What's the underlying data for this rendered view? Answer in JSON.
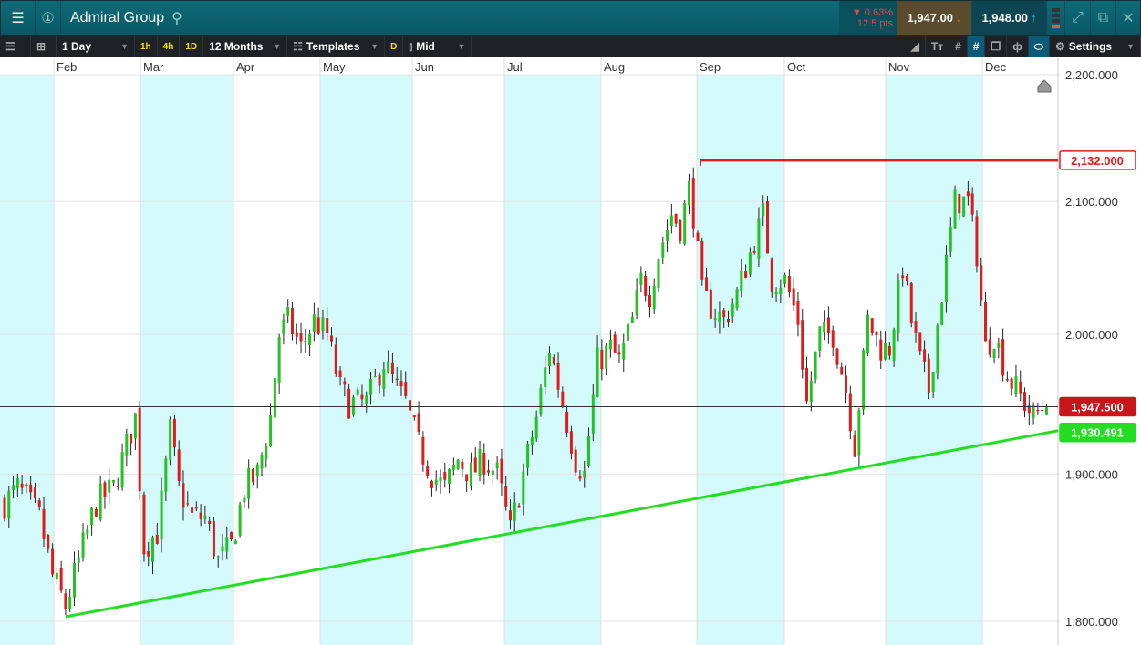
{
  "header": {
    "title": "Admiral Group",
    "change_pct": "▼ 0.63%",
    "change_pts": "12.5 pts",
    "sell": "1,947.00",
    "buy": "1,948.00"
  },
  "toolbar": {
    "interval": "1 Day",
    "quick": [
      "1h",
      "4h",
      "1D"
    ],
    "range": "12 Months",
    "templates": "Templates",
    "d": "D",
    "price_type": "Mid",
    "settings": "Settings"
  },
  "chart_data": {
    "type": "candlestick",
    "title": "Admiral Group",
    "scale": "log",
    "months": [
      "Feb",
      "Mar",
      "Apr",
      "May",
      "Jun",
      "Jul",
      "Aug",
      "Sep",
      "Oct",
      "Nov",
      "Dec"
    ],
    "yticks": [
      "2,200.000",
      "2,100.000",
      "2,000.000",
      "1,900.000",
      "1,800.000"
    ],
    "ytick_values": [
      2200,
      2100,
      2000,
      1900,
      1800
    ],
    "ylim": [
      1800,
      2200
    ],
    "close_path_day_index": [
      0,
      3,
      8,
      11,
      14,
      18,
      21,
      25,
      28,
      30,
      32,
      35,
      36,
      38,
      40,
      43,
      46,
      49,
      52,
      55,
      58,
      61,
      63,
      65,
      68,
      71,
      74,
      77,
      79,
      83,
      87,
      90,
      92,
      95,
      98,
      101,
      104,
      107,
      110,
      113,
      116,
      119,
      122,
      125,
      128,
      131,
      133,
      136,
      139,
      141,
      144,
      146,
      148,
      150,
      153,
      155,
      157,
      158,
      160,
      162,
      165,
      168,
      171,
      174,
      176,
      179,
      182,
      184,
      187,
      190,
      193,
      195,
      198,
      201,
      203,
      206,
      208,
      210,
      212,
      215,
      218,
      221,
      223,
      225,
      227,
      229,
      230,
      232,
      234,
      236,
      238,
      239
    ],
    "close_path": [
      1880,
      1890,
      1870,
      1830,
      1810,
      1850,
      1880,
      1890,
      1920,
      1940,
      1850,
      1860,
      1880,
      1930,
      1890,
      1870,
      1870,
      1840,
      1850,
      1890,
      1900,
      1940,
      2000,
      2010,
      1990,
      2010,
      2000,
      1960,
      1950,
      1950,
      1980,
      1960,
      1950,
      1920,
      1900,
      1890,
      1910,
      1900,
      1910,
      1900,
      1860,
      1900,
      1940,
      1990,
      1950,
      1910,
      1900,
      1980,
      1990,
      1980,
      2010,
      2040,
      2030,
      2060,
      2090,
      2080,
      2110,
      2090,
      2030,
      2020,
      2010,
      2030,
      2060,
      2090,
      2040,
      2040,
      2010,
      1950,
      2000,
      2000,
      1960,
      1920,
      2010,
      1990,
      1990,
      2050,
      2010,
      1980,
      1960,
      2030,
      2100,
      2100,
      2060,
      1990,
      2000,
      1980,
      1970,
      1960,
      1950,
      1940,
      1947,
      1947
    ],
    "resistance": {
      "value": 2132,
      "label": "2,132.000"
    },
    "current": {
      "value": 1947.5,
      "label": "1,947.500"
    },
    "trendline": {
      "from": 1803,
      "to": 1930.491,
      "label": "1,930.491"
    },
    "colors": {
      "up": "#22c322",
      "down": "#e01b1b",
      "trend": "#22dd22",
      "resistance": "#e01b1b",
      "band": "#d4fafc"
    }
  }
}
